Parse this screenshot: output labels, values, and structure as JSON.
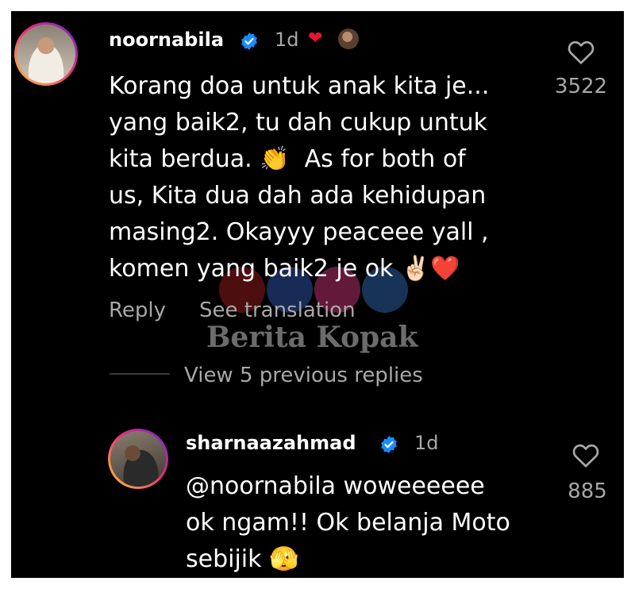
{
  "comment": {
    "username": "noornabila",
    "time": "1d",
    "text": "Korang doa untuk anak kita je...\nyang baik2, tu dah cukup untuk\nkita berdua. 👏  As for both of\nus, Kita dua dah ada kehidupan\nmasing2. Okayyy peaceee yall ,\nkomen yang baik2 je ok ✌🏻❤️",
    "reply_label": "Reply",
    "translate_label": "See translation",
    "likes": "3522"
  },
  "thread": {
    "view_replies_label": "View 5 previous replies"
  },
  "reply": {
    "username": "sharnaazahmad",
    "time": "1d",
    "text": "@noornabila woweeeeee\nok ngam!! Ok belanja Moto\nsebijik 🫣",
    "likes": "885"
  },
  "watermark": {
    "text": "Berita Kopak"
  },
  "colors": {
    "background": "#000000",
    "text": "#ffffff",
    "secondary_text": "#a8a8a8",
    "verified": "#1a8cff",
    "heart": "#e4152d"
  }
}
